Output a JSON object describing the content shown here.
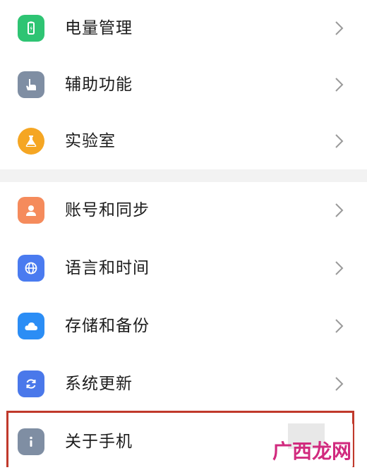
{
  "items": [
    {
      "label": "电量管理",
      "icon": "battery-icon",
      "color": "#2ec473"
    },
    {
      "label": "辅助功能",
      "icon": "hand-pointer-icon",
      "color": "#7f8ea3"
    },
    {
      "label": "实验室",
      "icon": "flask-icon",
      "color": "#f5a623"
    },
    {
      "label": "账号和同步",
      "icon": "person-icon",
      "color": "#f58b5c"
    },
    {
      "label": "语言和时间",
      "icon": "globe-icon",
      "color": "#4a7bf0"
    },
    {
      "label": "存储和备份",
      "icon": "cloud-icon",
      "color": "#2b8df5"
    },
    {
      "label": "系统更新",
      "icon": "refresh-icon",
      "color": "#4a78ea"
    },
    {
      "label": "关于手机",
      "icon": "info-icon",
      "color": "#7f8ea3"
    }
  ],
  "watermark": {
    "text": "广西龙网"
  },
  "colors": {
    "highlight_border": "#c0392b",
    "watermark_text": "#d12a7e"
  }
}
